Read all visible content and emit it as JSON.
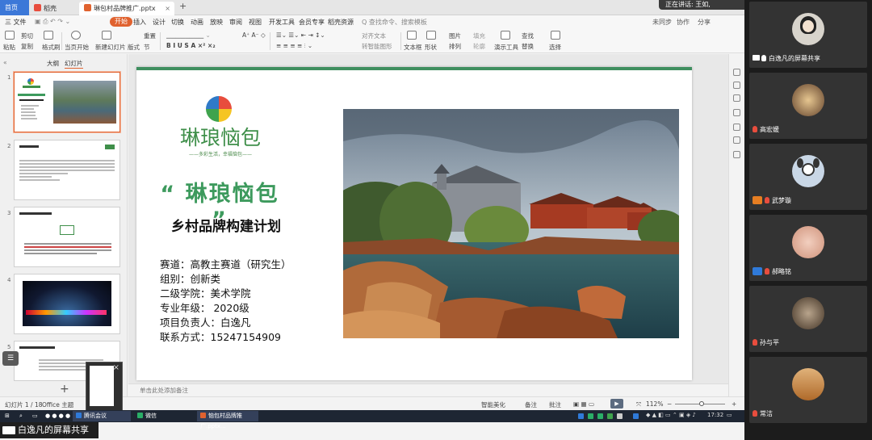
{
  "tabbar": {
    "tabs": [
      {
        "label": "首页"
      },
      {
        "label": "稻壳"
      },
      {
        "label": "琳包村品牌推广.pptx"
      }
    ],
    "speaking_label": "正在讲话: 王如,"
  },
  "menubar": {
    "file_label": "三 文件",
    "items": [
      "开始",
      "插入",
      "设计",
      "切换",
      "动画",
      "放映",
      "审阅",
      "视图",
      "开发工具",
      "会员专享",
      "稻壳资源"
    ],
    "search_placeholder": "Q 查找命令、搜索模板",
    "sync_label": "未同步",
    "collab_label": "协作",
    "share_label": "分享"
  },
  "ribbon": {
    "paste": "粘贴",
    "cut": "剪切",
    "copy": "复制",
    "format_painter": "格式刷",
    "play_from_current": "当页开始",
    "new_slide": "新建幻灯片",
    "layout": "版式",
    "section": "节",
    "reset": "重置",
    "text_box": "文本框",
    "shape": "形状",
    "arrange": "排列",
    "image": "图片",
    "fill": "填充",
    "outline": "轮廓",
    "presentation_tools": "演示工具",
    "find": "查找",
    "replace": "替换",
    "select": "选择",
    "convert_graphic": "转智能图形",
    "text_direction": "对齐文本"
  },
  "thumbpane": {
    "tab_outline": "大纲",
    "tab_slides": "幻灯片",
    "slide_numbers": [
      "1",
      "2",
      "3",
      "4",
      "5"
    ]
  },
  "slide": {
    "logo_text": "琳琅恼包",
    "logo_slogan": "——多彩生活，幸福恼包——",
    "title": "“ 琳琅恼包 ”",
    "subtitle": "乡村品牌构建计划",
    "info": [
      "赛道：高教主赛道（研究生）",
      "组别：创新类",
      "二级学院：美术学院",
      "专业年级： 2020级",
      "项目负责人：白逸凡",
      "联系方式：15247154909"
    ]
  },
  "notes": {
    "placeholder": "单击此处添加备注"
  },
  "statusbar": {
    "slide_count": "幻灯片 1 / 18",
    "theme": "Office 主题",
    "smart_beautify": "智能美化",
    "notes_btn": "备注",
    "comments_btn": "批注",
    "zoom": "112%"
  },
  "taskbar": {
    "tasks": [
      "腾讯会议",
      "微信",
      "恼包村品牌推广.pptx..."
    ],
    "time": "17:32"
  },
  "share_bar": {
    "label": "白逸凡的屏幕共享"
  },
  "participants": [
    {
      "name": "白逸凡的屏幕共享",
      "color": "#d8d4cc"
    },
    {
      "name": "高宏媛",
      "color": "#7a5a3a"
    },
    {
      "name": "武梦璇",
      "color": "#9cb7d6"
    },
    {
      "name": "郝略铭",
      "color": "#d9a690"
    },
    {
      "name": "孙与平",
      "color": "#8a7a6a"
    },
    {
      "name": "常洁",
      "color": "#c08a4a"
    }
  ],
  "colors": {
    "accent": "#e0622f",
    "brand_green": "#3d9a5d",
    "tab_blue": "#3c78d8"
  }
}
